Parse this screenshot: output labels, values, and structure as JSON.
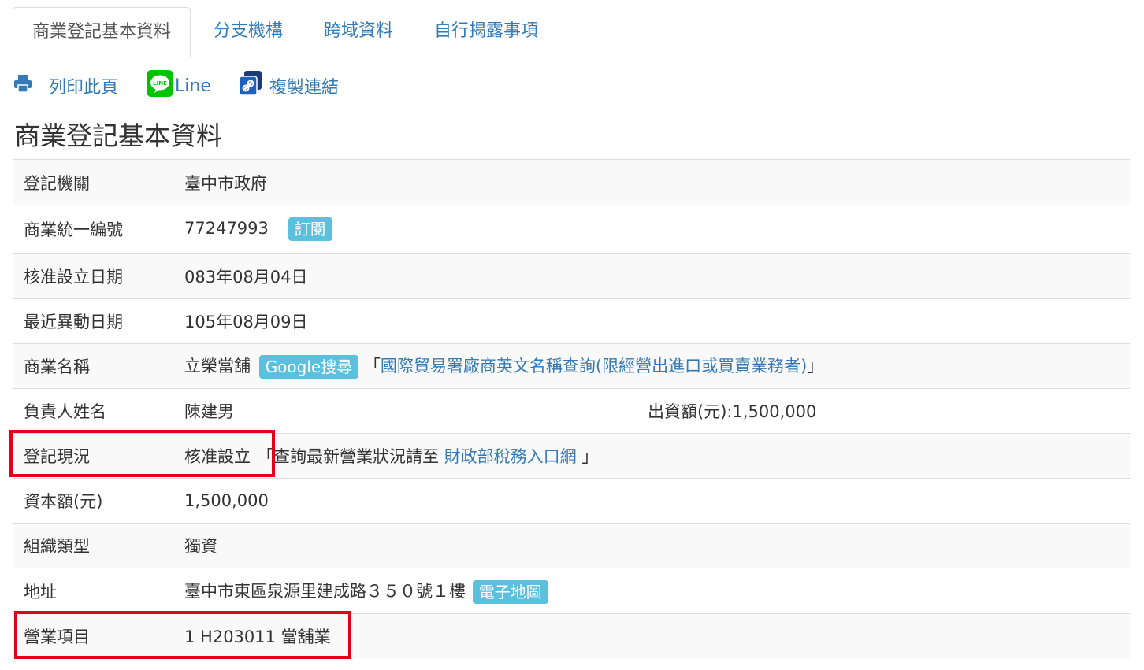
{
  "tabs": [
    {
      "label": "商業登記基本資料",
      "active": true
    },
    {
      "label": "分支機構"
    },
    {
      "label": "跨域資料"
    },
    {
      "label": "自行揭露事項"
    }
  ],
  "toolbar": {
    "print_label": "列印此頁",
    "line_label": "Line",
    "line_icon_text": "LINE",
    "copy_label": "複製連結"
  },
  "title": "商業登記基本資料",
  "rows": {
    "agency": {
      "label": "登記機關",
      "value": "臺中市政府"
    },
    "id": {
      "label": "商業統一編號",
      "value": "77247993",
      "badge": "訂閱"
    },
    "est_date": {
      "label": "核准設立日期",
      "value": "083年08月04日"
    },
    "change_date": {
      "label": "最近異動日期",
      "value": "105年08月09日"
    },
    "name": {
      "label": "商業名稱",
      "value": "立榮當舖",
      "badge": "Google搜尋",
      "link_prefix": "「",
      "link": "國際貿易署廠商英文名稱查詢(限經營出進口或買賣業務者)",
      "link_suffix": "」"
    },
    "owner": {
      "label": "負責人姓名",
      "value": "陳建男",
      "extra": "出資額(元):1,500,000"
    },
    "status": {
      "label": "登記現況",
      "value": "核准設立",
      "note_prefix": "「查詢最新營業狀況請至 ",
      "link": "財政部稅務入口網",
      "note_suffix": " 」"
    },
    "capital": {
      "label": "資本額(元)",
      "value": "1,500,000"
    },
    "org_type": {
      "label": "組織類型",
      "value": "獨資"
    },
    "address": {
      "label": "地址",
      "value": "臺中市東區泉源里建成路３５０號１樓",
      "badge": "電子地圖"
    },
    "business": {
      "label": "營業項目",
      "value": "1 H203011 當舖業"
    }
  },
  "colors": {
    "link": "#337ab7",
    "badge": "#5bc0de",
    "highlight": "#e0001a",
    "line_green": "#00c300"
  }
}
